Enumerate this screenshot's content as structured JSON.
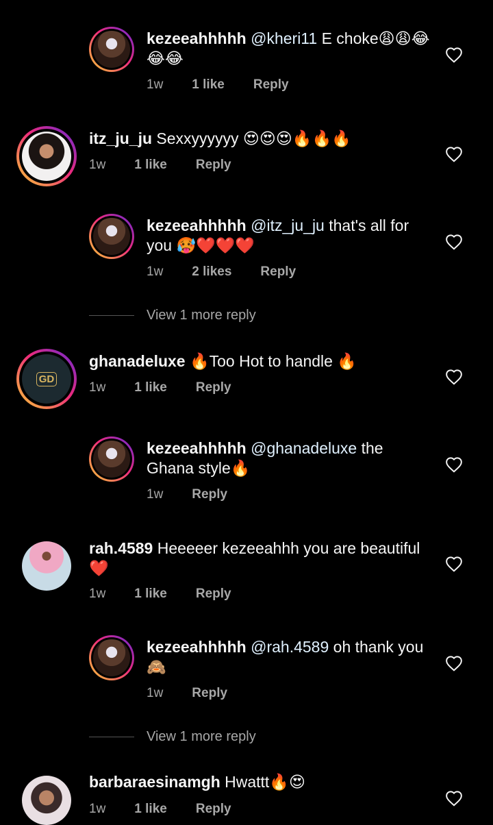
{
  "comments": [
    {
      "username": "kezeeahhhhh",
      "mention": "@kheri11",
      "text": " E choke😩😩😂😂😂",
      "time": "1w",
      "likes": "1 like",
      "reply": "Reply"
    },
    {
      "username": "itz_ju_ju",
      "mention": "",
      "text": " Sexxyyyyyy 😍😍😍🔥🔥🔥",
      "time": "1w",
      "likes": "1 like",
      "reply": "Reply"
    },
    {
      "username": "kezeeahhhhh",
      "mention": "@itz_ju_ju",
      "text": " that's all for you 🥵❤️❤️❤️",
      "time": "1w",
      "likes": "2 likes",
      "reply": "Reply"
    },
    {
      "username": "ghanadeluxe",
      "mention": "",
      "text": " 🔥Too Hot to handle 🔥",
      "time": "1w",
      "likes": "1 like",
      "reply": "Reply"
    },
    {
      "username": "kezeeahhhhh",
      "mention": "@ghanadeluxe",
      "text": " the Ghana style🔥",
      "time": "1w",
      "likes": "",
      "reply": "Reply"
    },
    {
      "username": "rah.4589",
      "mention": "",
      "text": " Heeeeer kezeeahhh you are beautiful ❤️",
      "time": "1w",
      "likes": "1 like",
      "reply": "Reply"
    },
    {
      "username": "kezeeahhhhh",
      "mention": "@rah.4589",
      "text": " oh thank you 🙈",
      "time": "1w",
      "likes": "",
      "reply": "Reply"
    },
    {
      "username": "barbaraesinamgh",
      "mention": "",
      "text": " Hwattt🔥😍",
      "time": "1w",
      "likes": "1 like",
      "reply": "Reply"
    }
  ],
  "view_more": [
    "View 1 more reply",
    "View 1 more reply"
  ],
  "icons": {
    "like": "heart-outline-icon",
    "logo": "gd-logo"
  },
  "colors": {
    "background": "#000000",
    "text": "#f5f5f5",
    "muted": "#a8a8a8",
    "ring_start": "#f9ce34",
    "ring_mid": "#ee2a7b",
    "ring_end": "#6228d7"
  }
}
